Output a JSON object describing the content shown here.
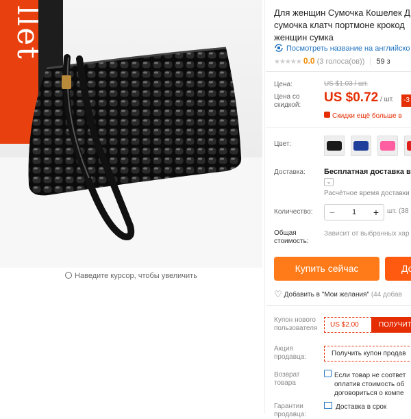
{
  "product": {
    "title_lines": [
      "Для женщин Сумочка Кошелек Д",
      "сумочка клатч портмоне крокод",
      "женщин сумка"
    ],
    "translate_link": "Посмотреть название на английско",
    "rating_stars": "★★★★★",
    "rating_score": "0.0",
    "rating_count": "(3 голоса(ов))",
    "orders": "59 з"
  },
  "gallery": {
    "book_text": "llet",
    "zoom_hint": "Наведите курсор, чтобы увеличить",
    "icon": "magnifier-icon"
  },
  "price": {
    "label": "Цена:",
    "old_value": "US $1.03 / шт.",
    "discount_label_1": "Цена со",
    "discount_label_2": "скидкой:",
    "value": "US $0.72",
    "unit": " / шт.",
    "discount_badge": "-3",
    "extra_discount": "Скидки ещё больше в"
  },
  "color": {
    "label": "Цвет:",
    "swatches": [
      {
        "name": "black",
        "hex": "#1a1a1a"
      },
      {
        "name": "blue",
        "hex": "#1f3f9a"
      },
      {
        "name": "pink",
        "hex": "#ff5fa0"
      },
      {
        "name": "red",
        "hex": "#e0201c"
      }
    ]
  },
  "shipping": {
    "label": "Доставка:",
    "value": "Бесплатная доставка в R",
    "dropdown_icon": "⌄",
    "note": "Расчётное время доставки"
  },
  "quantity": {
    "label": "Количество:",
    "minus": "−",
    "value": "1",
    "plus": "+",
    "unit": "шт. (38"
  },
  "total": {
    "label_1": "Общая",
    "label_2": "стоимость:",
    "note": "Зависит от выбранных хар"
  },
  "actions": {
    "buy_now": "Купить сейчас",
    "add_to_cart": "До",
    "wishlist": "Добавить в \"Мои желания\"",
    "wishlist_count": "(44 добав"
  },
  "coupons": {
    "new_user_label_1": "Купон нового",
    "new_user_label_2": "пользователя",
    "new_user_value": "US $2.00",
    "get_button": "ПОЛУЧИТЕ",
    "seller_label_1": "Акция",
    "seller_label_2": "продавца:",
    "seller_value": "Получить купон продав"
  },
  "returns": {
    "label_1": "Возврат",
    "label_2": "товара",
    "line_1": "Если товар не соответ",
    "line_2": "оплатив стоимость об",
    "line_3": "договориться о компе"
  },
  "guarantee": {
    "label_1": "Гарантии",
    "label_2": "продавца:",
    "value": "Доставка в срок"
  },
  "colors": {
    "accent": "#e62e04",
    "buy": "#ff7b1a",
    "cart": "#ff5a0f",
    "link": "#2073c0",
    "rating": "#f08a00"
  }
}
